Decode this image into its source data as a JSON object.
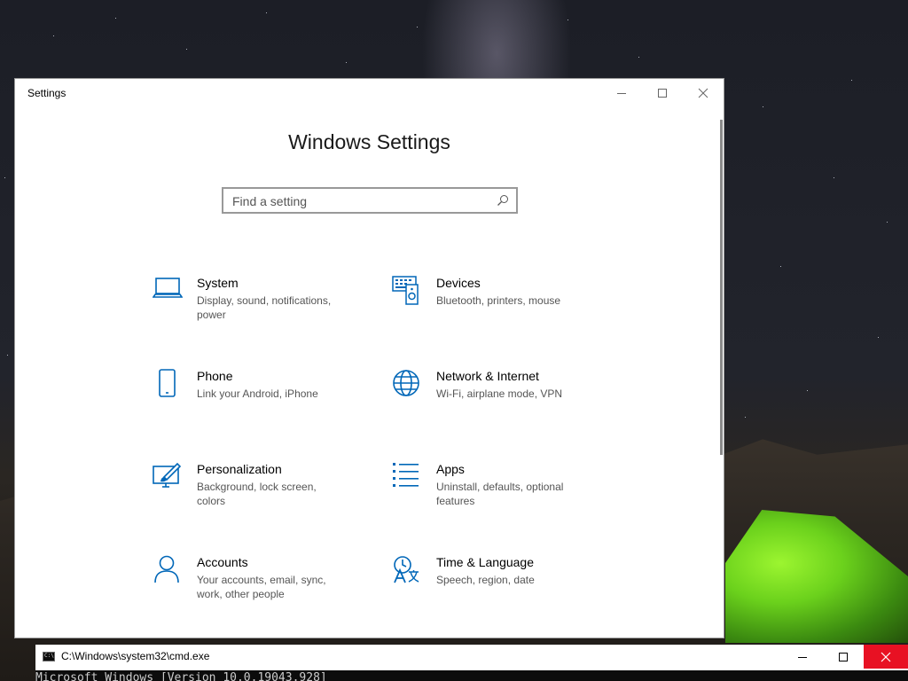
{
  "settings_window": {
    "title": "Settings",
    "page_title": "Windows Settings",
    "search": {
      "placeholder": "Find a setting",
      "value": ""
    },
    "categories": [
      {
        "name": "System",
        "description": "Display, sound, notifications, power",
        "icon": "laptop-icon"
      },
      {
        "name": "Devices",
        "description": "Bluetooth, printers, mouse",
        "icon": "devices-icon"
      },
      {
        "name": "Phone",
        "description": "Link your Android, iPhone",
        "icon": "phone-icon"
      },
      {
        "name": "Network & Internet",
        "description": "Wi-Fi, airplane mode, VPN",
        "icon": "globe-icon"
      },
      {
        "name": "Personalization",
        "description": "Background, lock screen, colors",
        "icon": "paint-brush-icon"
      },
      {
        "name": "Apps",
        "description": "Uninstall, defaults, optional features",
        "icon": "apps-list-icon"
      },
      {
        "name": "Accounts",
        "description": "Your accounts, email, sync, work, other people",
        "icon": "person-icon"
      },
      {
        "name": "Time & Language",
        "description": "Speech, region, date",
        "icon": "time-language-icon"
      }
    ]
  },
  "cmd_window": {
    "title": "C:\\Windows\\system32\\cmd.exe",
    "icon_label": "C:\\",
    "output_line": "Microsoft Windows [Version 10.0.19043.928]"
  },
  "colors": {
    "accent": "#0067b8",
    "close_red": "#e81123"
  }
}
